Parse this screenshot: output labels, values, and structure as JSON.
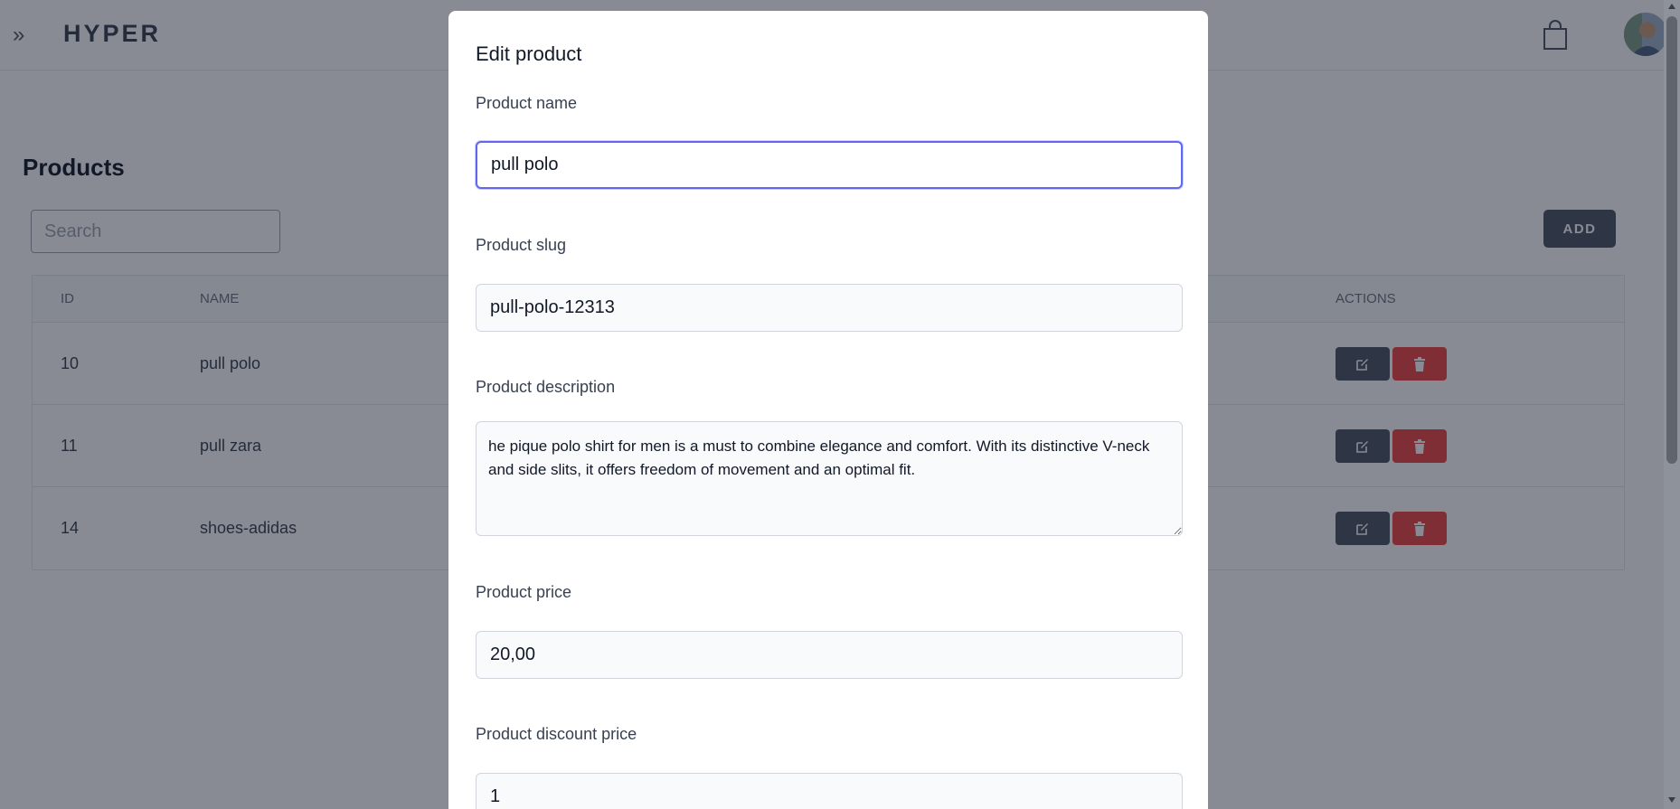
{
  "header": {
    "brand": "HYPER",
    "menu_icon": "double-chevron-right-icon",
    "cart_icon": "shopping-bag-icon",
    "avatar_icon": "user-avatar"
  },
  "page": {
    "title": "Products",
    "search_placeholder": "Search",
    "add_label": "ADD"
  },
  "table": {
    "columns": [
      "ID",
      "NAME",
      "ACTIONS"
    ],
    "rows": [
      {
        "id": "10",
        "name": "pull polo"
      },
      {
        "id": "11",
        "name": "pull zara"
      },
      {
        "id": "14",
        "name": "shoes-adidas"
      }
    ],
    "edit_icon": "edit-icon",
    "delete_icon": "trash-icon"
  },
  "modal": {
    "title": "Edit product",
    "fields": {
      "name": {
        "label": "Product name",
        "value": "pull polo"
      },
      "slug": {
        "label": "Product slug",
        "value": "pull-polo-12313"
      },
      "description": {
        "label": "Product description",
        "value": "he pique polo shirt for men is a must to combine elegance and comfort. With its distinctive V-neck and side slits, it offers freedom of movement and an optimal fit."
      },
      "price": {
        "label": "Product price",
        "value": "20,00"
      },
      "discount_price": {
        "label": "Product discount price",
        "value": "1"
      }
    }
  },
  "colors": {
    "accent_focus": "#6366f1",
    "primary_button": "#4b5563",
    "danger_button": "#ef4444",
    "overlay": "rgba(17,24,39,0.5)"
  }
}
